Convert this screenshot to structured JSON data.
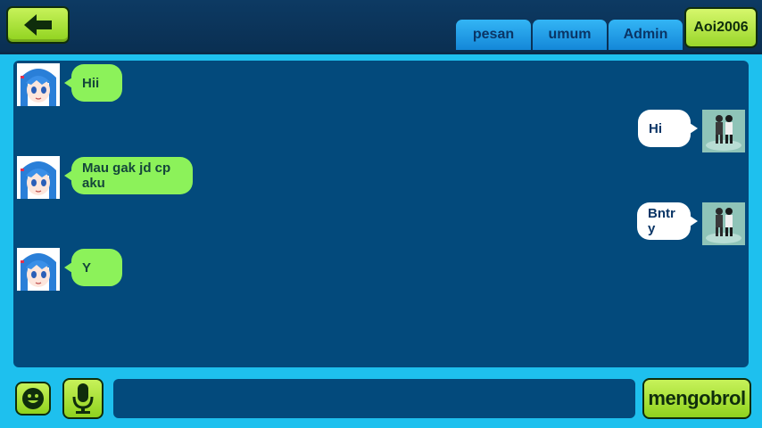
{
  "header": {
    "back_icon": "arrow-left-icon",
    "tabs": [
      {
        "label": "pesan"
      },
      {
        "label": "umum"
      },
      {
        "label": "Admin"
      }
    ],
    "active_user": "Aoi2006"
  },
  "messages": [
    {
      "side": "left",
      "text": "Hii"
    },
    {
      "side": "right",
      "text": "Hi"
    },
    {
      "side": "left",
      "text": "Mau gak jd cp aku"
    },
    {
      "side": "right",
      "text": "Bntr y"
    },
    {
      "side": "left",
      "text": "Y"
    }
  ],
  "composer": {
    "emoji_icon": "smiley-icon",
    "mic_icon": "microphone-icon",
    "input_value": "",
    "send_label": "mengobrol"
  },
  "colors": {
    "background": "#1ec0ee",
    "panel": "#034a7c",
    "accent_green": "#8cf25a",
    "tab_blue": "#1487d8"
  }
}
